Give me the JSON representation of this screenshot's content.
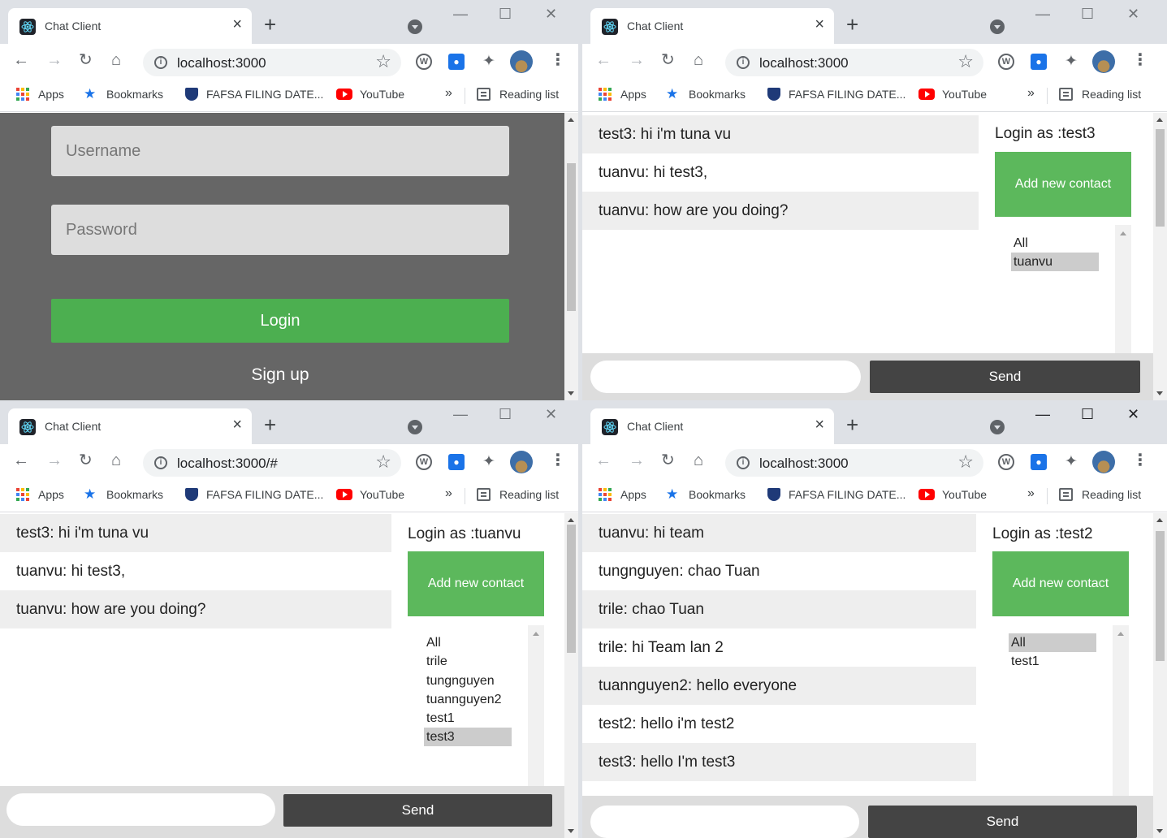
{
  "browser": {
    "tab_title": "Chat Client",
    "url_main": "localhost:3000",
    "url_hash": "localhost:3000/#",
    "bookmarks": {
      "apps": "Apps",
      "bookmarks": "Bookmarks",
      "fafsa": "FAFSA FILING DATE...",
      "youtube": "YouTube",
      "more": "»",
      "reading_list": "Reading list"
    }
  },
  "login_page": {
    "username_placeholder": "Username",
    "password_placeholder": "Password",
    "login_label": "Login",
    "signup_label": "Sign up"
  },
  "chat_test3": {
    "login_as": "Login as :test3",
    "add_contact": "Add new contact",
    "messages": [
      "test3: hi i'm tuna vu",
      "tuanvu: hi test3,",
      "tuanvu: how are you doing?"
    ],
    "contacts": [
      "All",
      "tuanvu"
    ],
    "selected_contact": "tuanvu",
    "send_label": "Send"
  },
  "chat_tuanvu": {
    "login_as": "Login as :tuanvu",
    "add_contact": "Add new contact",
    "messages": [
      "test3: hi i'm tuna vu",
      "tuanvu: hi test3,",
      "tuanvu: how are you doing?"
    ],
    "contacts": [
      "All",
      "trile",
      "tungnguyen",
      "tuannguyen2",
      "test1",
      "test3"
    ],
    "selected_contact": "test3",
    "send_label": "Send"
  },
  "chat_test2": {
    "login_as": "Login as :test2",
    "add_contact": "Add new contact",
    "messages": [
      "tuanvu: hi team",
      "tungnguyen: chao Tuan",
      "trile: chao Tuan",
      "trile: hi Team lan 2",
      "tuannguyen2: hello everyone",
      "test2: hello i'm test2",
      "test3: hello I'm test3"
    ],
    "contacts": [
      "All",
      "test1"
    ],
    "selected_contact": "All",
    "send_label": "Send"
  },
  "colors": {
    "login_bg": "#666666",
    "login_button": "#4caf50",
    "add_contact_button": "#5cb85c",
    "send_button": "#444444",
    "selected_contact": "#cccccc"
  },
  "icons": [
    "react-favicon",
    "back-icon",
    "forward-icon",
    "reload-icon",
    "home-icon",
    "info-icon",
    "star-icon",
    "extension-w-icon",
    "extension-drop-icon",
    "puzzle-icon",
    "kebab-icon",
    "apps-grid-icon",
    "fafsa-shield-icon",
    "youtube-icon",
    "reading-list-icon"
  ]
}
